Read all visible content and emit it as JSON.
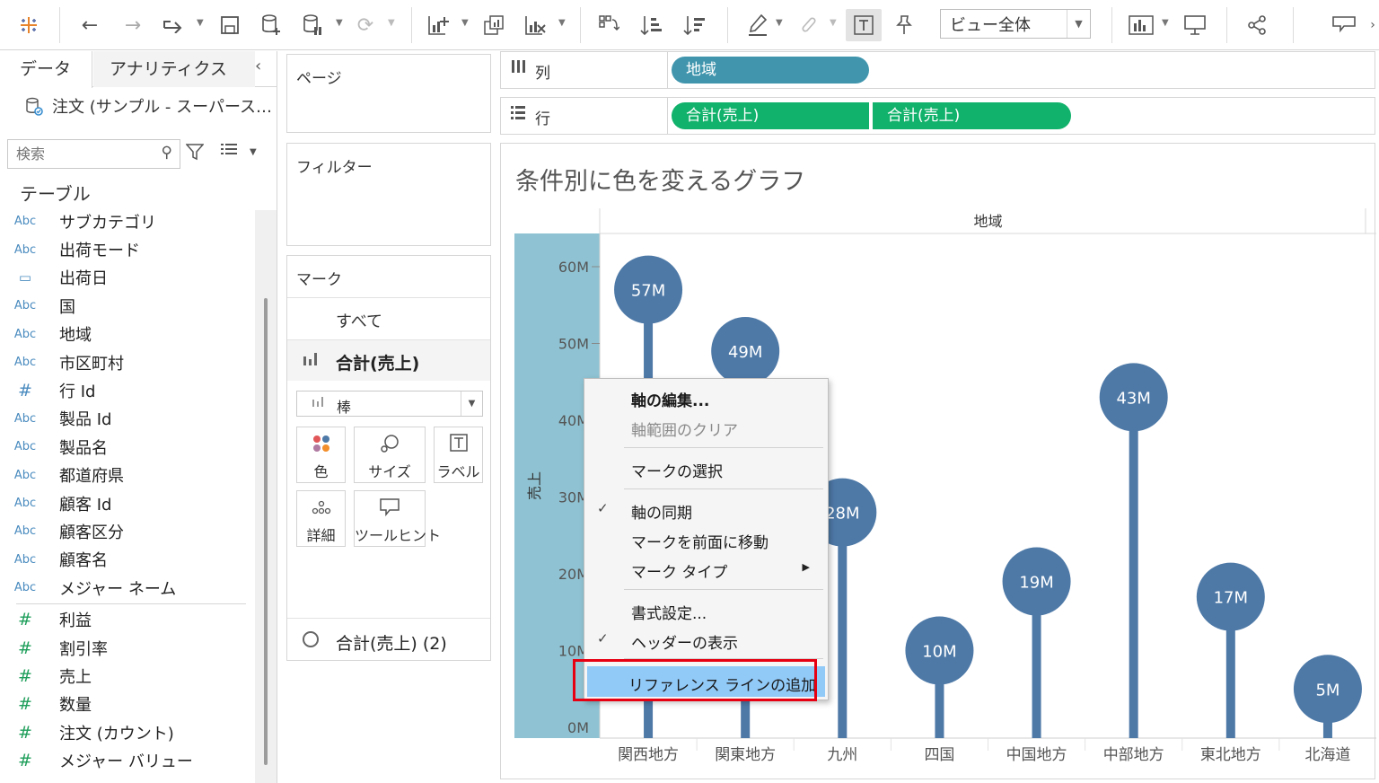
{
  "toolbar": {
    "view_mode": "ビュー全体"
  },
  "data_pane": {
    "tabs": [
      "データ",
      "アナリティクス"
    ],
    "datasource": "注文 (サンプル - スーパース…",
    "search_placeholder": "検索",
    "tables_heading": "テーブル",
    "dimensions": [
      {
        "type": "Abc",
        "name": "サブカテゴリ"
      },
      {
        "type": "Abc",
        "name": "出荷モード"
      },
      {
        "type": "date",
        "name": "出荷日"
      },
      {
        "type": "Abc",
        "name": "国"
      },
      {
        "type": "Abc",
        "name": "地域"
      },
      {
        "type": "Abc",
        "name": "市区町村"
      },
      {
        "type": "#",
        "name": "行 Id"
      },
      {
        "type": "Abc",
        "name": "製品 Id"
      },
      {
        "type": "Abc",
        "name": "製品名"
      },
      {
        "type": "Abc",
        "name": "都道府県"
      },
      {
        "type": "Abc",
        "name": "顧客 Id"
      },
      {
        "type": "Abc",
        "name": "顧客区分"
      },
      {
        "type": "Abc",
        "name": "顧客名"
      },
      {
        "type": "Abc",
        "name": "メジャー ネーム"
      }
    ],
    "measures": [
      {
        "type": "#",
        "name": "利益"
      },
      {
        "type": "#",
        "name": "割引率"
      },
      {
        "type": "#",
        "name": "売上"
      },
      {
        "type": "#",
        "name": "数量"
      },
      {
        "type": "#",
        "name": "注文 (カウント)"
      },
      {
        "type": "#",
        "name": "メジャー バリュー"
      }
    ]
  },
  "cards": {
    "pages": "ページ",
    "filters": "フィルター",
    "marks": "マーク",
    "marks_all": "すべて",
    "marks_sum1": "合計(売上)",
    "mark_type": "棒",
    "mark_buttons": [
      "色",
      "サイズ",
      "ラベル",
      "詳細",
      "ツールヒント"
    ],
    "marks_sum2": "合計(売上) (2)"
  },
  "shelves": {
    "columns_label": "列",
    "rows_label": "行",
    "columns_pills": [
      "地域"
    ],
    "rows_pills": [
      "合計(売上)",
      "合計(売上)"
    ]
  },
  "chart_data": {
    "type": "bar",
    "title": "条件別に色を変えるグラフ",
    "header": "地域",
    "ylabel": "売上",
    "ylim": [
      0,
      60000000
    ],
    "yticks": [
      "0M",
      "10M",
      "20M",
      "30M",
      "40M",
      "50M",
      "60M"
    ],
    "categories": [
      "関西地方",
      "関東地方",
      "九州",
      "四国",
      "中国地方",
      "中部地方",
      "東北地方",
      "北海道"
    ],
    "values": [
      57,
      49,
      28,
      10,
      19,
      43,
      17,
      5
    ],
    "value_unit": "M",
    "data_labels": [
      "57M",
      "49M",
      "28M",
      "10M",
      "19M",
      "43M",
      "17M",
      "5M"
    ],
    "color": "#4e79a7",
    "axis_highlight_color": "#8fc3d3"
  },
  "context_menu": {
    "items": [
      {
        "label": "軸の編集...",
        "bold": true,
        "checked": false,
        "disabled": false,
        "submenu": false
      },
      {
        "label": "軸範囲のクリア",
        "bold": false,
        "checked": false,
        "disabled": true,
        "submenu": false
      },
      {
        "label": "マークの選択",
        "bold": false,
        "checked": false,
        "disabled": false,
        "submenu": false
      },
      {
        "label": "軸の同期",
        "bold": false,
        "checked": true,
        "disabled": false,
        "submenu": false
      },
      {
        "label": "マークを前面に移動",
        "bold": false,
        "checked": false,
        "disabled": false,
        "submenu": false
      },
      {
        "label": "マーク タイプ",
        "bold": false,
        "checked": false,
        "disabled": false,
        "submenu": true
      },
      {
        "label": "書式設定...",
        "bold": false,
        "checked": false,
        "disabled": false,
        "submenu": false
      },
      {
        "label": "ヘッダーの表示",
        "bold": false,
        "checked": true,
        "disabled": false,
        "submenu": false
      },
      {
        "label": "リファレンス ラインの追加",
        "bold": false,
        "checked": false,
        "disabled": false,
        "submenu": false,
        "highlighted": true
      }
    ]
  }
}
